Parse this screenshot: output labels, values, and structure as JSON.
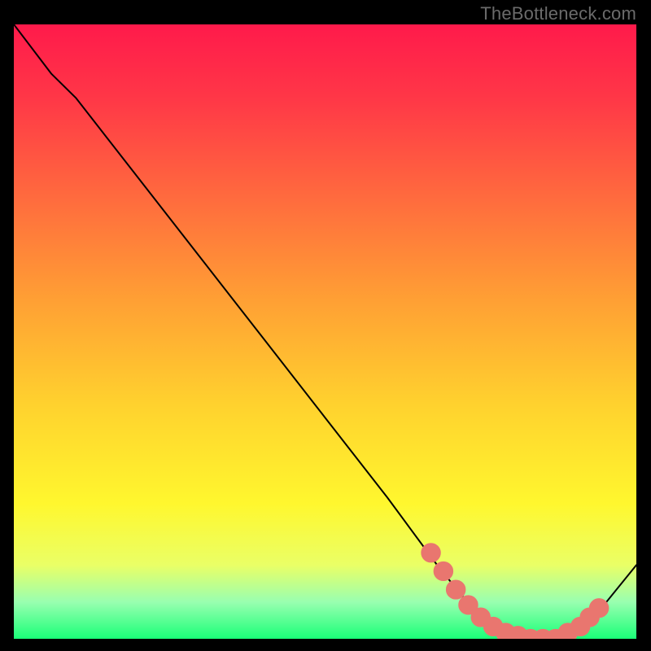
{
  "watermark": "TheBottleneck.com",
  "colors": {
    "background": "#000000",
    "curve": "#000000",
    "marker_fill": "#e9766f",
    "marker_stroke": "#e9766f",
    "gradient_stops": [
      {
        "offset": 0.0,
        "color": "#ff1a4b"
      },
      {
        "offset": 0.12,
        "color": "#ff3747"
      },
      {
        "offset": 0.28,
        "color": "#ff6a3e"
      },
      {
        "offset": 0.45,
        "color": "#ffa034"
      },
      {
        "offset": 0.62,
        "color": "#ffd22e"
      },
      {
        "offset": 0.78,
        "color": "#fff72e"
      },
      {
        "offset": 0.88,
        "color": "#eaff66"
      },
      {
        "offset": 0.94,
        "color": "#99ffb0"
      },
      {
        "offset": 1.0,
        "color": "#1aff78"
      }
    ]
  },
  "chart_data": {
    "type": "line",
    "title": "",
    "xlabel": "",
    "ylabel": "",
    "xlim": [
      0,
      100
    ],
    "ylim": [
      0,
      100
    ],
    "series": [
      {
        "name": "curve",
        "x": [
          0,
          6,
          10,
          20,
          30,
          40,
          50,
          60,
          68,
          72,
          76,
          80,
          84,
          88,
          92,
          100
        ],
        "y": [
          100,
          92,
          88,
          75,
          62,
          49,
          36,
          23,
          12,
          7,
          3,
          1,
          0,
          0,
          2,
          12
        ]
      }
    ],
    "markers": {
      "name": "highlight-points",
      "points": [
        {
          "x": 67,
          "y": 14
        },
        {
          "x": 69,
          "y": 11
        },
        {
          "x": 71,
          "y": 8
        },
        {
          "x": 73,
          "y": 5.5
        },
        {
          "x": 75,
          "y": 3.5
        },
        {
          "x": 77,
          "y": 2
        },
        {
          "x": 79,
          "y": 1
        },
        {
          "x": 81,
          "y": 0.5
        },
        {
          "x": 83,
          "y": 0
        },
        {
          "x": 85,
          "y": 0
        },
        {
          "x": 87,
          "y": 0
        },
        {
          "x": 89,
          "y": 1
        },
        {
          "x": 91,
          "y": 2
        },
        {
          "x": 92.5,
          "y": 3.5
        },
        {
          "x": 94,
          "y": 5
        }
      ]
    }
  }
}
